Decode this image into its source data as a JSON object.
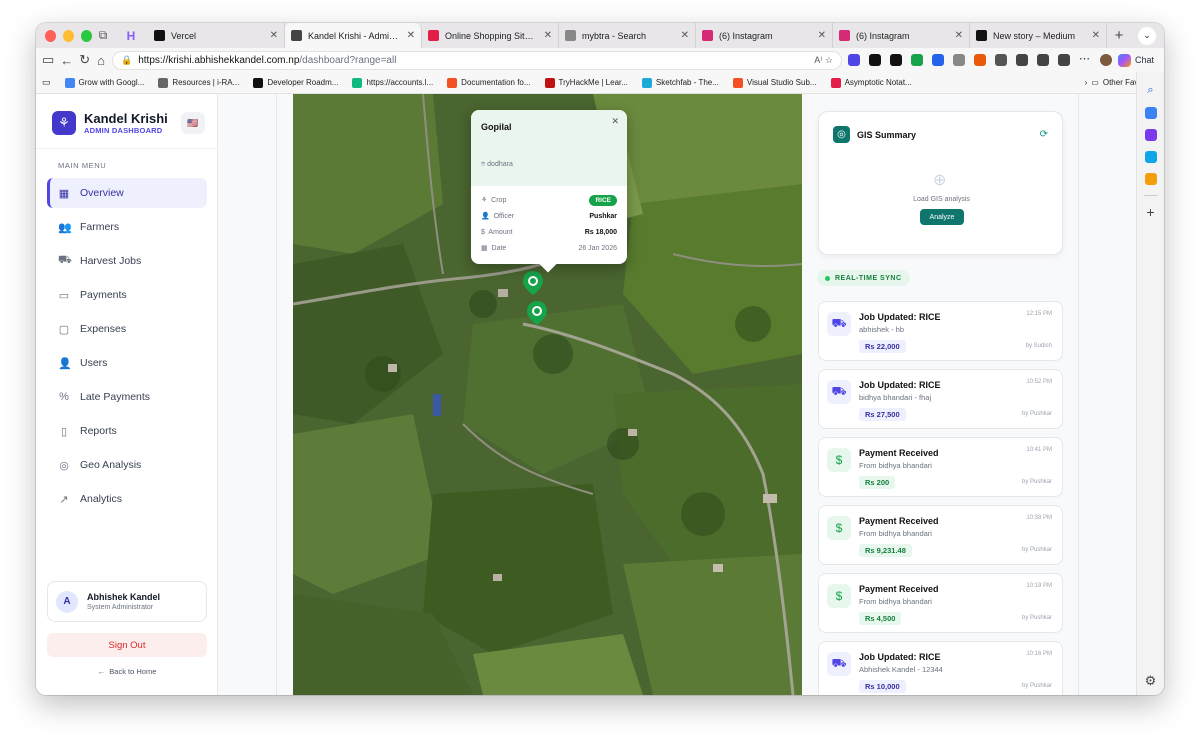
{
  "browser": {
    "tabs": [
      {
        "label": "Vercel",
        "fav_color": "#111111",
        "active": false
      },
      {
        "label": "Kandel Krishi - Admin Dashb",
        "fav_color": "#444444",
        "active": true
      },
      {
        "label": "Online Shopping Site - Shop",
        "fav_color": "#e11d48",
        "active": false
      },
      {
        "label": "mybtra - Search",
        "fav_color": "#888888",
        "active": false
      },
      {
        "label": "(6) Instagram",
        "fav_color": "#d62976",
        "active": false
      },
      {
        "label": "(6) Instagram",
        "fav_color": "#d62976",
        "active": false
      },
      {
        "label": "New story – Medium",
        "fav_color": "#111111",
        "active": false
      }
    ],
    "url_host": "https://krishi.abhishekkandel.com.np",
    "url_path": "/dashboard?range=all",
    "chat_label": "Chat",
    "bookmarks": [
      {
        "label": "Grow with Googl...",
        "color": "#4285f4"
      },
      {
        "label": "Resources | i-RA...",
        "color": "#666666"
      },
      {
        "label": "Developer Roadm...",
        "color": "#111111"
      },
      {
        "label": "https://accounts.l...",
        "color": "#10b981"
      },
      {
        "label": "Documentation fo...",
        "color": "#f25022"
      },
      {
        "label": "TryHackMe | Lear...",
        "color": "#c11111"
      },
      {
        "label": "Sketchfab - The...",
        "color": "#1caad9"
      },
      {
        "label": "Visual Studio Sub...",
        "color": "#f25022"
      },
      {
        "label": "Asymptotic Notat...",
        "color": "#e11d48"
      }
    ],
    "other_favorites": "Other Favorites"
  },
  "sidebar": {
    "app_name": "Kandel Krishi",
    "app_sub": "ADMIN DASHBOARD",
    "flag": "🇺🇸",
    "menu_title": "MAIN MENU",
    "items": [
      {
        "label": "Overview",
        "icon": "grid-icon",
        "glyph": "▦",
        "active": true
      },
      {
        "label": "Farmers",
        "icon": "users-icon",
        "glyph": "👥",
        "active": false
      },
      {
        "label": "Harvest Jobs",
        "icon": "tractor-icon",
        "glyph": "⛟",
        "active": false
      },
      {
        "label": "Payments",
        "icon": "banknote-icon",
        "glyph": "▭",
        "active": false
      },
      {
        "label": "Expenses",
        "icon": "receipt-icon",
        "glyph": "▢",
        "active": false
      },
      {
        "label": "Users",
        "icon": "user-icon",
        "glyph": "👤",
        "active": false
      },
      {
        "label": "Late Payments",
        "icon": "percent-icon",
        "glyph": "%",
        "active": false
      },
      {
        "label": "Reports",
        "icon": "file-icon",
        "glyph": "▯",
        "active": false
      },
      {
        "label": "Geo Analysis",
        "icon": "globe-icon",
        "glyph": "◎",
        "active": false
      },
      {
        "label": "Analytics",
        "icon": "trend-icon",
        "glyph": "↗",
        "active": false
      }
    ],
    "user": {
      "initial": "A",
      "name": "Abhishek Kandel",
      "role": "System Administrator"
    },
    "sign_out": "Sign Out",
    "back_home": "Back to Home"
  },
  "map_popup": {
    "name": "Gopilal",
    "location": "dodhara",
    "rows": [
      {
        "label": "Crop",
        "value": "RICE",
        "kind": "badge"
      },
      {
        "label": "Officer",
        "value": "Pushkar",
        "kind": "text"
      },
      {
        "label": "Amount",
        "value": "Rs 18,000",
        "kind": "green"
      },
      {
        "label": "Date",
        "value": "26 Jan 2026",
        "kind": "muted"
      }
    ]
  },
  "gis": {
    "title": "GIS Summary",
    "load_text": "Load GIS analysis",
    "analyze": "Analyze"
  },
  "sync_label": "REAL-TIME SYNC",
  "activities": [
    {
      "type": "job",
      "title": "Job Updated: RICE",
      "sub": "abhishek - hb",
      "amount": "Rs 22,000",
      "time": "12:15 PM",
      "by": "by Sudish"
    },
    {
      "type": "job",
      "title": "Job Updated: RICE",
      "sub": "bidhya bhandari - fhaj",
      "amount": "Rs 27,500",
      "time": "10:52 PM",
      "by": "by Pushkar"
    },
    {
      "type": "pay",
      "title": "Payment Received",
      "sub": "From bidhya bhandari",
      "amount": "Rs 200",
      "time": "10:41 PM",
      "by": "by Pushkar"
    },
    {
      "type": "pay",
      "title": "Payment Received",
      "sub": "From bidhya bhandari",
      "amount": "Rs 9,231.48",
      "time": "10:38 PM",
      "by": "by Pushkar"
    },
    {
      "type": "pay",
      "title": "Payment Received",
      "sub": "From bidhya bhandari",
      "amount": "Rs 4,500",
      "time": "10:19 PM",
      "by": "by Pushkar"
    },
    {
      "type": "job",
      "title": "Job Updated: RICE",
      "sub": "Abhishek Kandel - 12344",
      "amount": "Rs 10,000",
      "time": "10:16 PM",
      "by": "by Pushkar"
    }
  ],
  "colors": {
    "accent": "#4f46e5",
    "teal": "#0f766e",
    "green": "#16a34a",
    "danger": "#dc2626"
  }
}
